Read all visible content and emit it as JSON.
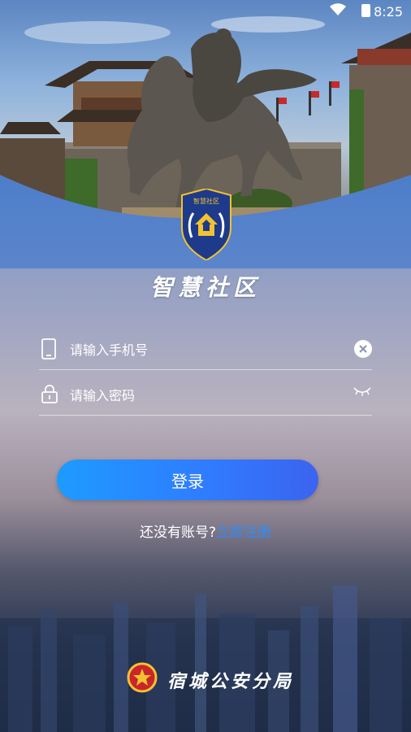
{
  "status_bar": {
    "time": "8:25"
  },
  "badge": {
    "text": "智慧社区"
  },
  "app": {
    "title": "智慧社区"
  },
  "form": {
    "phone_placeholder": "请输入手机号",
    "phone_value": "",
    "password_placeholder": "请输入密码",
    "password_value": "",
    "login_label": "登录"
  },
  "register": {
    "prompt": "还没有账号?",
    "link": "立即注册"
  },
  "footer": {
    "org": "宿城公安分局"
  },
  "colors": {
    "accent": "#2d8cff",
    "button_start": "#1e9bff",
    "button_end": "#3b63f0",
    "badge_blue": "#1e3a8a",
    "badge_gold": "#f2c230"
  }
}
